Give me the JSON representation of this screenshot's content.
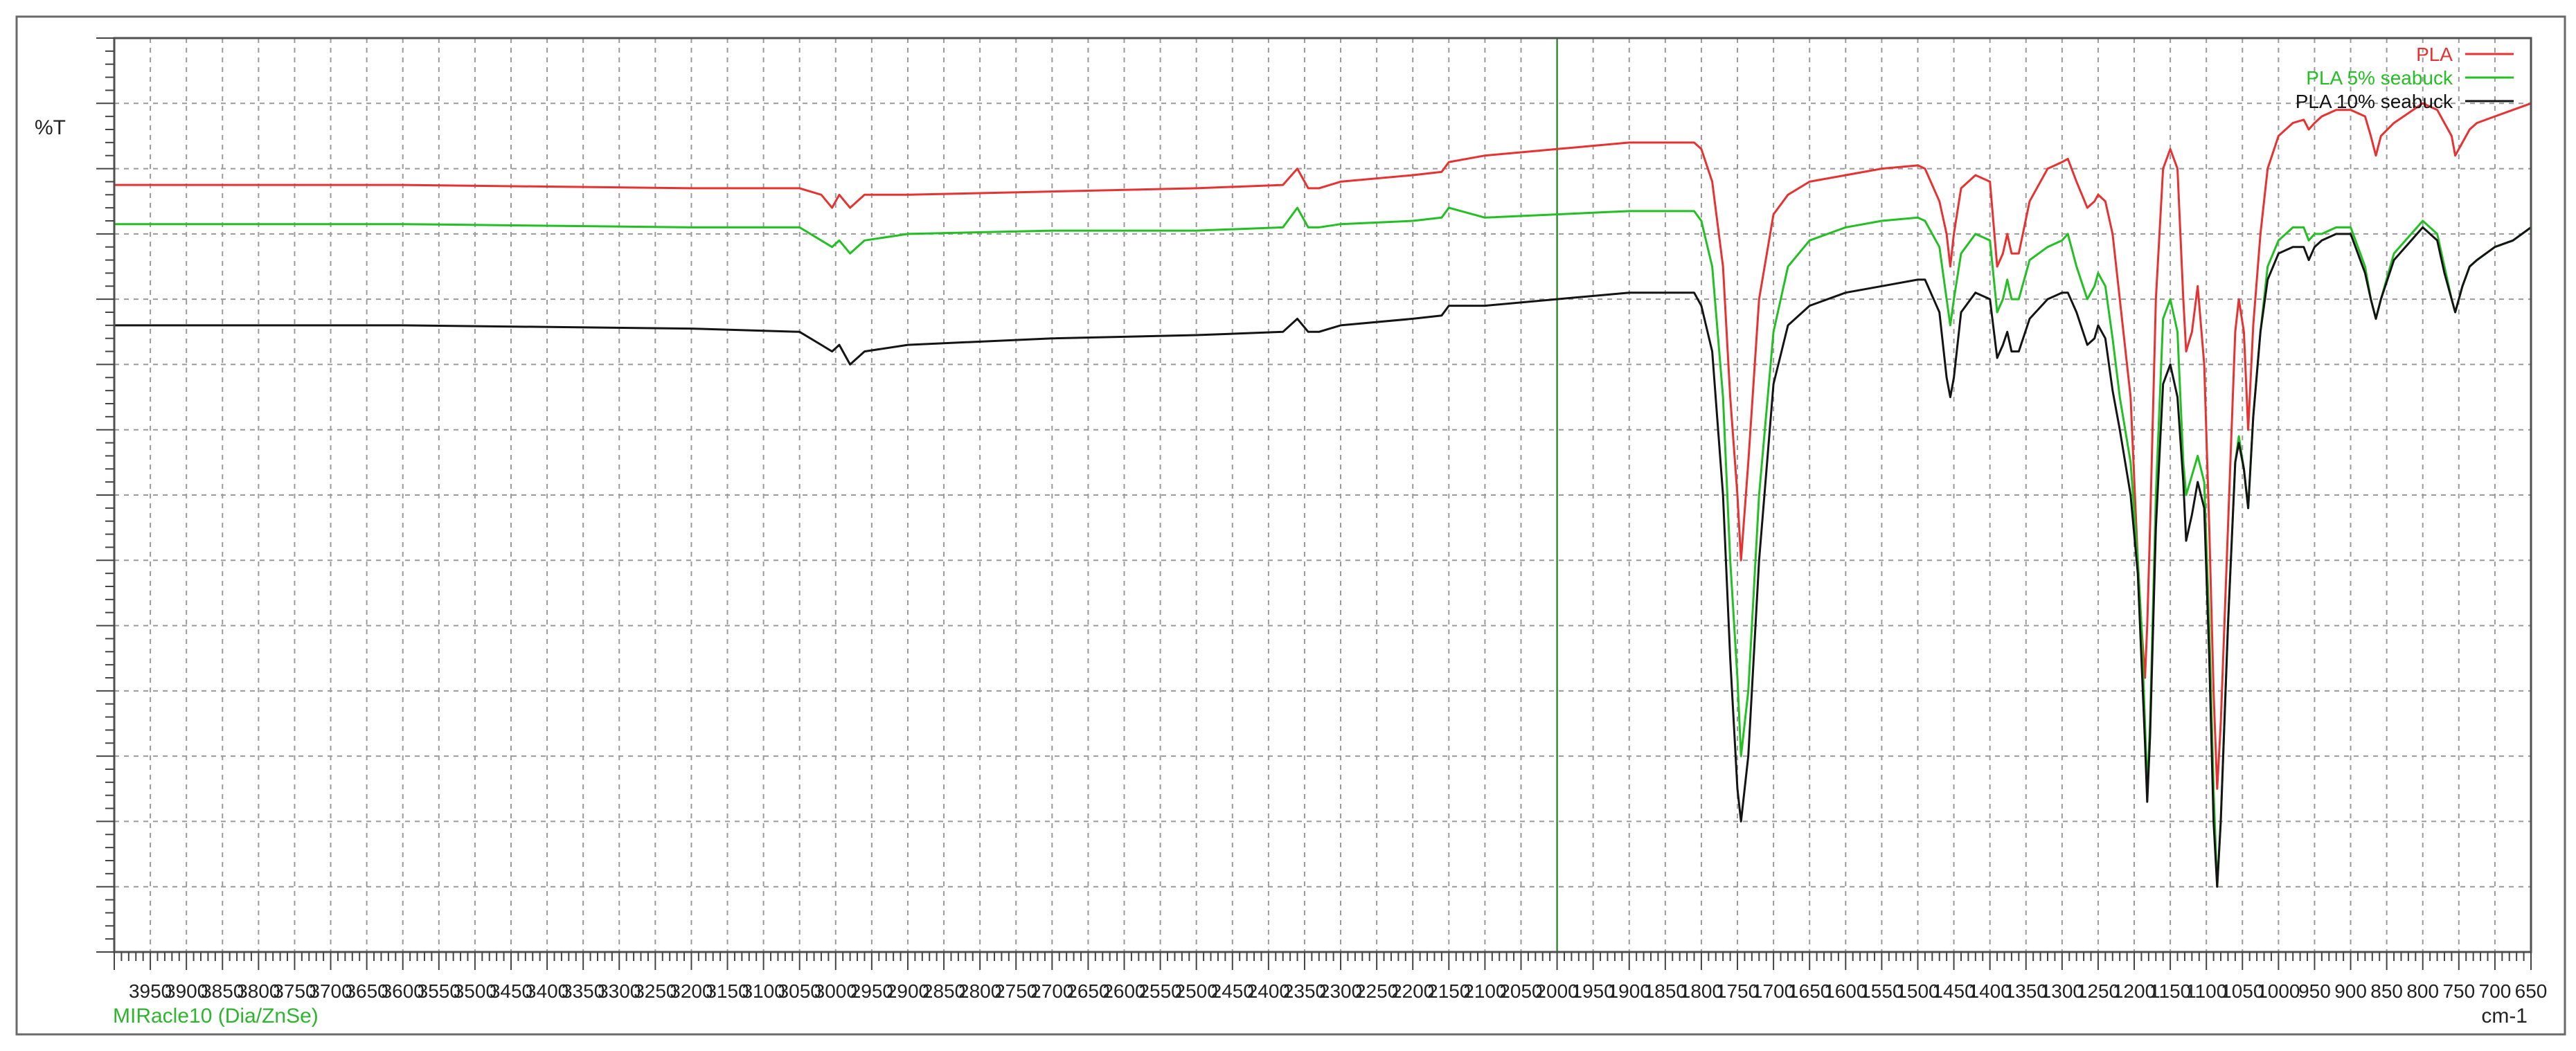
{
  "header": {
    "y_unit": "%T"
  },
  "footer": {
    "accessory": "MIRacle10 (Dia/ZnSe)",
    "x_unit": "cm-1"
  },
  "colors": {
    "frame": "#505050",
    "grid": "#9a9a9a",
    "marker": "#3a8a3a",
    "accessory_text": "#2db52d"
  },
  "chart_data": {
    "type": "line",
    "title": "",
    "xlabel": "cm-1",
    "ylabel": "%T",
    "xlim": [
      4000,
      650
    ],
    "x_reversed": true,
    "ylim": [
      -30,
      110
    ],
    "y_tick_labels_shown": false,
    "grid": true,
    "legend_position": "top-right",
    "x_ticks": [
      3950,
      3900,
      3850,
      3800,
      3750,
      3700,
      3650,
      3600,
      3550,
      3500,
      3450,
      3400,
      3350,
      3300,
      3250,
      3200,
      3150,
      3100,
      3050,
      3000,
      2950,
      2900,
      2850,
      2800,
      2750,
      2700,
      2650,
      2600,
      2550,
      2500,
      2450,
      2400,
      2350,
      2300,
      2250,
      2200,
      2150,
      2100,
      2050,
      2000,
      1950,
      1900,
      1850,
      1800,
      1750,
      1700,
      1650,
      1600,
      1550,
      1500,
      1450,
      1400,
      1350,
      1300,
      1250,
      1200,
      1150,
      1100,
      1050,
      1000,
      950,
      900,
      850,
      800,
      750,
      700,
      650
    ],
    "x_tick_labels": [
      "3950",
      "3900",
      "3850",
      "3800",
      "3750",
      "3700",
      "3650",
      "3600",
      "3550",
      "3500",
      "3450",
      "3400",
      "3350",
      "3300",
      "3250",
      "3200",
      "3150",
      "3100",
      "3050",
      "3000",
      "2950",
      "2900",
      "2850",
      "2800",
      "2750",
      "2700",
      "2650",
      "2600",
      "2550",
      "2500",
      "2450",
      "2400",
      "2350",
      "2300",
      "2250",
      "2200",
      "2150",
      "2100",
      "2050",
      "2000",
      "1950",
      "1900",
      "1850",
      "1800",
      "1750",
      "1700",
      "1650",
      "1600",
      "1550",
      "1500",
      "1450",
      "1400",
      "1350",
      "1300",
      "1250",
      "1200",
      "1150",
      "1100",
      "1050",
      "1000",
      "950",
      "900",
      "850",
      "800",
      "750",
      "700",
      "650"
    ],
    "y_ticks": [
      -20,
      -10,
      0,
      10,
      20,
      30,
      40,
      50,
      60,
      70,
      80,
      90,
      100
    ],
    "markers": [
      {
        "x": 2000
      }
    ],
    "series": [
      {
        "name": "PLA",
        "color": "#e83232",
        "x": [
          4000,
          3600,
          3200,
          3050,
          3020,
          3005,
          2995,
          2980,
          2960,
          2900,
          2700,
          2500,
          2380,
          2360,
          2345,
          2330,
          2300,
          2200,
          2160,
          2150,
          2100,
          2000,
          1900,
          1850,
          1810,
          1800,
          1785,
          1770,
          1760,
          1750,
          1745,
          1735,
          1720,
          1700,
          1680,
          1650,
          1600,
          1550,
          1500,
          1490,
          1470,
          1460,
          1455,
          1450,
          1440,
          1420,
          1400,
          1390,
          1382,
          1376,
          1370,
          1360,
          1345,
          1320,
          1300,
          1292,
          1280,
          1265,
          1255,
          1250,
          1240,
          1230,
          1220,
          1205,
          1195,
          1190,
          1185,
          1182,
          1178,
          1170,
          1160,
          1150,
          1140,
          1132,
          1128,
          1120,
          1112,
          1103,
          1096,
          1090,
          1085,
          1080,
          1070,
          1060,
          1055,
          1048,
          1042,
          1035,
          1025,
          1015,
          1000,
          980,
          965,
          958,
          950,
          940,
          920,
          900,
          880,
          872,
          865,
          858,
          840,
          800,
          780,
          770,
          760,
          755,
          745,
          735,
          725,
          700,
          675,
          650
        ],
        "y": [
          87.5,
          87.5,
          87,
          87,
          86,
          84,
          86,
          84,
          86,
          86,
          86.5,
          87,
          87.5,
          90,
          87,
          87,
          88,
          89,
          89.5,
          91,
          92,
          93,
          94,
          94,
          94,
          93,
          88,
          75,
          55,
          40,
          30,
          45,
          70,
          83,
          86,
          88,
          89,
          90,
          90.5,
          90,
          85,
          80,
          75,
          80,
          87,
          89,
          88,
          75,
          77,
          80,
          77,
          77,
          85,
          90,
          91,
          91.5,
          88,
          84,
          85,
          86,
          85,
          80,
          70,
          55,
          30,
          20,
          12,
          20,
          35,
          70,
          90,
          93,
          90,
          70,
          62,
          65,
          72,
          60,
          35,
          10,
          -5,
          5,
          35,
          65,
          70,
          65,
          50,
          66,
          80,
          90,
          95,
          97,
          97.5,
          96,
          97,
          98,
          99,
          99,
          98,
          95,
          92,
          95,
          97,
          100,
          99,
          97,
          95,
          92,
          94,
          96,
          97,
          98,
          99,
          100
        ]
      },
      {
        "name": "PLA 5% seabuck",
        "color": "#22c022",
        "x": [
          4000,
          3600,
          3200,
          3050,
          3020,
          3005,
          2995,
          2980,
          2960,
          2900,
          2700,
          2500,
          2380,
          2360,
          2345,
          2330,
          2300,
          2200,
          2160,
          2150,
          2100,
          2000,
          1900,
          1850,
          1810,
          1800,
          1785,
          1770,
          1760,
          1750,
          1745,
          1735,
          1720,
          1700,
          1680,
          1650,
          1600,
          1550,
          1500,
          1490,
          1470,
          1460,
          1455,
          1450,
          1440,
          1420,
          1400,
          1390,
          1382,
          1376,
          1370,
          1360,
          1345,
          1320,
          1300,
          1292,
          1280,
          1265,
          1255,
          1250,
          1240,
          1230,
          1220,
          1205,
          1195,
          1190,
          1185,
          1182,
          1178,
          1170,
          1160,
          1150,
          1140,
          1132,
          1128,
          1120,
          1112,
          1103,
          1096,
          1090,
          1085,
          1080,
          1070,
          1060,
          1055,
          1048,
          1042,
          1035,
          1025,
          1015,
          1000,
          980,
          965,
          958,
          950,
          940,
          920,
          900,
          880,
          872,
          865,
          858,
          840,
          800,
          780,
          770,
          760,
          755,
          745,
          735,
          725,
          700,
          675,
          650
        ],
        "y": [
          81.5,
          81.5,
          81,
          81,
          79,
          78,
          79,
          77,
          79,
          80,
          80.5,
          80.5,
          81,
          84,
          81,
          81,
          81.5,
          82,
          82.5,
          84,
          82.5,
          83,
          83.5,
          83.5,
          83.5,
          82,
          75,
          55,
          30,
          12,
          0,
          10,
          40,
          65,
          75,
          79,
          81,
          82,
          82.5,
          82,
          78,
          70,
          66,
          70,
          77,
          80,
          79,
          68,
          70,
          73,
          70,
          70,
          76,
          78,
          79,
          80,
          75,
          70,
          72,
          74,
          72,
          64,
          55,
          45,
          30,
          20,
          5,
          -5,
          5,
          40,
          67,
          70,
          65,
          45,
          40,
          43,
          46,
          42,
          20,
          -5,
          -20,
          -10,
          20,
          45,
          49,
          44,
          38,
          52,
          65,
          75,
          79,
          81,
          81,
          79,
          80,
          80,
          81,
          81,
          75,
          70,
          67,
          70,
          77,
          82,
          80,
          75,
          70,
          68,
          72,
          75,
          76,
          78,
          79,
          81
        ]
      },
      {
        "name": "PLA 10% seabuck",
        "color": "#141414",
        "x": [
          4000,
          3600,
          3200,
          3050,
          3020,
          3005,
          2995,
          2980,
          2960,
          2900,
          2700,
          2500,
          2380,
          2360,
          2345,
          2330,
          2300,
          2200,
          2160,
          2150,
          2100,
          2000,
          1900,
          1850,
          1810,
          1800,
          1785,
          1770,
          1760,
          1750,
          1745,
          1735,
          1720,
          1700,
          1680,
          1650,
          1600,
          1550,
          1500,
          1490,
          1470,
          1460,
          1455,
          1450,
          1440,
          1420,
          1400,
          1390,
          1382,
          1376,
          1370,
          1360,
          1345,
          1320,
          1300,
          1292,
          1280,
          1265,
          1255,
          1250,
          1240,
          1230,
          1220,
          1205,
          1195,
          1190,
          1185,
          1182,
          1178,
          1170,
          1160,
          1150,
          1140,
          1132,
          1128,
          1120,
          1112,
          1103,
          1096,
          1090,
          1085,
          1080,
          1070,
          1060,
          1055,
          1048,
          1042,
          1035,
          1025,
          1015,
          1000,
          980,
          965,
          958,
          950,
          940,
          920,
          900,
          880,
          872,
          865,
          858,
          840,
          800,
          780,
          770,
          760,
          755,
          745,
          735,
          725,
          700,
          675,
          650
        ],
        "y": [
          66,
          66,
          65.5,
          65,
          63,
          62,
          63,
          60,
          62,
          63,
          64,
          64.5,
          65,
          67,
          65,
          65,
          66,
          67,
          67.5,
          69,
          69,
          70,
          71,
          71,
          71,
          69,
          62,
          40,
          15,
          -5,
          -10,
          0,
          30,
          57,
          66,
          69,
          71,
          72,
          73,
          73,
          68,
          58,
          55,
          58,
          68,
          71,
          70,
          61,
          63,
          65,
          62,
          62,
          67,
          70,
          71,
          71,
          68,
          63,
          64,
          66,
          64,
          56,
          50,
          40,
          28,
          15,
          2,
          -7,
          3,
          35,
          57,
          60,
          55,
          42,
          33,
          37,
          42,
          38,
          15,
          -10,
          -20,
          -10,
          20,
          45,
          48,
          44,
          38,
          52,
          65,
          73,
          77,
          78,
          78,
          76,
          78,
          79,
          80,
          80,
          74,
          70,
          67,
          70,
          76,
          81,
          79,
          74,
          70,
          68,
          72,
          75,
          76,
          78,
          79,
          81
        ]
      }
    ]
  }
}
